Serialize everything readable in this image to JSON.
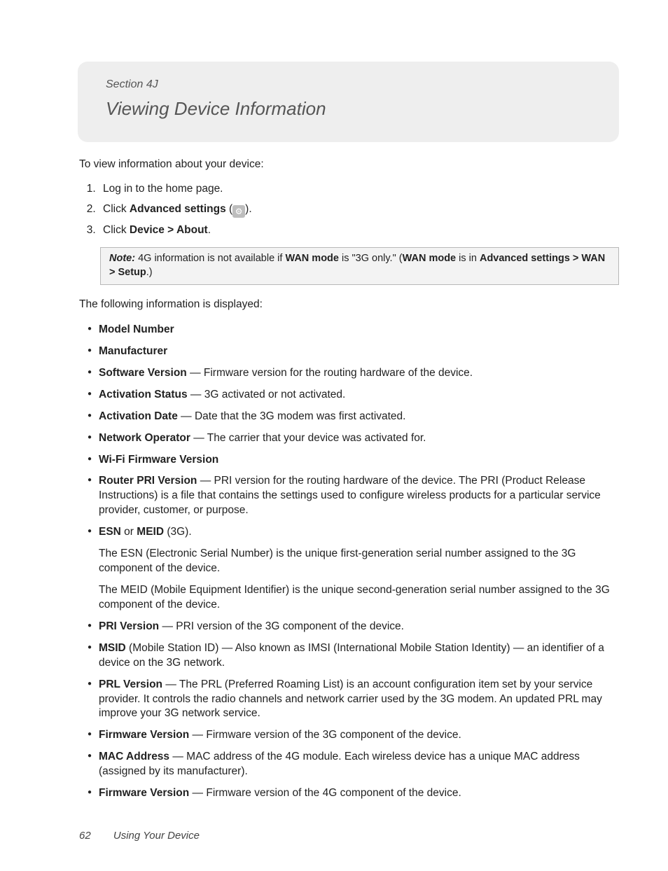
{
  "header": {
    "section_label": "Section 4J",
    "title": "Viewing Device Information"
  },
  "intro": "To view information about your device:",
  "steps": {
    "s1": "Log in to the home page.",
    "s2_a": "Click ",
    "s2_b": "Advanced settings",
    "s2_c": " (",
    "s2_d": ").",
    "s3_a": "Click ",
    "s3_b": "Device > About",
    "s3_c": "."
  },
  "note": {
    "lead": "Note:",
    "a": "  4G information is not available if ",
    "b": "WAN mode",
    "c": " is \"3G only.\" (",
    "d": "WAN mode",
    "e": " is in ",
    "f": "Advanced settings > WAN > Setup",
    "g": ".)"
  },
  "list_intro": "The following information is displayed:",
  "items": {
    "model": "Model Number",
    "manu": "Manufacturer",
    "soft_b": "Software Version",
    "soft_t": " — Firmware version for the routing hardware of the device.",
    "act_s_b": "Activation Status",
    "act_s_t": " — 3G activated or not activated.",
    "act_d_b": "Activation Date",
    "act_d_t": " — Date that the 3G modem was first activated.",
    "net_b": "Network Operator",
    "net_t": " — The carrier that your device was activated for.",
    "wifi": "Wi-Fi Firmware Version",
    "rpri_b": "Router PRI Version",
    "rpri_t": " — PRI version for the routing hardware of the device. The PRI (Product Release Instructions) is a file that contains the settings used to configure wireless products for a particular service provider, customer, or purpose.",
    "esn_b1": "ESN",
    "esn_or": " or ",
    "esn_b2": "MEID",
    "esn_t": " (3G).",
    "esn_p1": "The ESN (Electronic Serial Number) is the unique first-generation serial number assigned to the 3G component of the device.",
    "esn_p2": "The MEID (Mobile Equipment Identifier) is the unique second-generation serial number assigned to the 3G component of the device.",
    "pri_b": "PRI Version",
    "pri_t": " — PRI version of the 3G component of the device.",
    "msid_b": "MSID",
    "msid_t": " (Mobile Station ID) — Also known as IMSI (International Mobile Station Identity) — an identifier of a device on the 3G network.",
    "prl_b": "PRL Version",
    "prl_t": " — The PRL (Preferred Roaming List) is an account configuration item set by your service provider. It controls the radio channels and network carrier used by the 3G modem. An updated PRL may improve your 3G network service.",
    "fw3_b": "Firmware Version",
    "fw3_t": " — Firmware version of the 3G component of the device.",
    "mac_b": "MAC Address",
    "mac_t": " — MAC address of the 4G module. Each wireless device has a unique MAC address (assigned by its manufacturer).",
    "fw4_b": "Firmware Version",
    "fw4_t": " — Firmware version of the 4G component of the device."
  },
  "footer": {
    "page": "62",
    "title": "Using Your Device"
  }
}
